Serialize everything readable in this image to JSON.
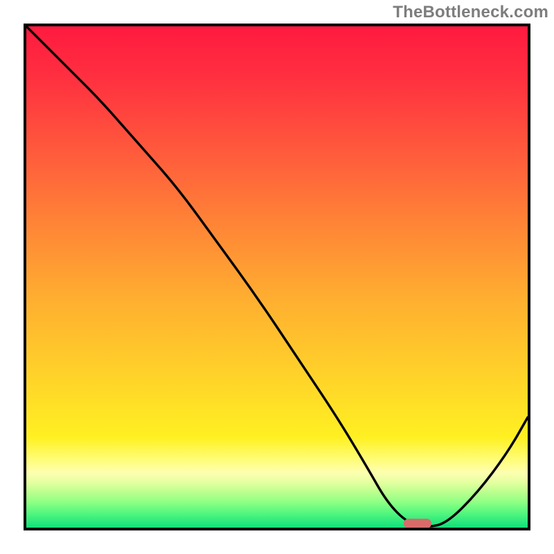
{
  "watermark": "TheBottleneck.com",
  "chart_data": {
    "type": "line",
    "title": "",
    "xlabel": "",
    "ylabel": "",
    "xlim": [
      0,
      100
    ],
    "ylim": [
      0,
      100
    ],
    "grid": false,
    "legend": false,
    "background": {
      "kind": "vertical-gradient",
      "stops": [
        {
          "pct": 0,
          "color": "#ff1a3f"
        },
        {
          "pct": 25,
          "color": "#ff5a3c"
        },
        {
          "pct": 55,
          "color": "#ffb030"
        },
        {
          "pct": 82,
          "color": "#fff022"
        },
        {
          "pct": 95,
          "color": "#8cff84"
        },
        {
          "pct": 100,
          "color": "#12df7a"
        }
      ]
    },
    "series": [
      {
        "name": "bottleneck-curve",
        "x": [
          0,
          8,
          15,
          22,
          30,
          38,
          46,
          54,
          62,
          68,
          72,
          76,
          80,
          84,
          90,
          96,
          100
        ],
        "y": [
          100,
          92,
          85,
          77,
          68,
          57,
          46,
          34,
          22,
          12,
          5,
          1,
          0,
          1,
          7,
          15,
          22
        ]
      }
    ],
    "annotations": [
      {
        "name": "optimal-marker",
        "shape": "rounded-rect",
        "x": 78,
        "y": 0.8,
        "color": "#d96b6b"
      }
    ]
  }
}
